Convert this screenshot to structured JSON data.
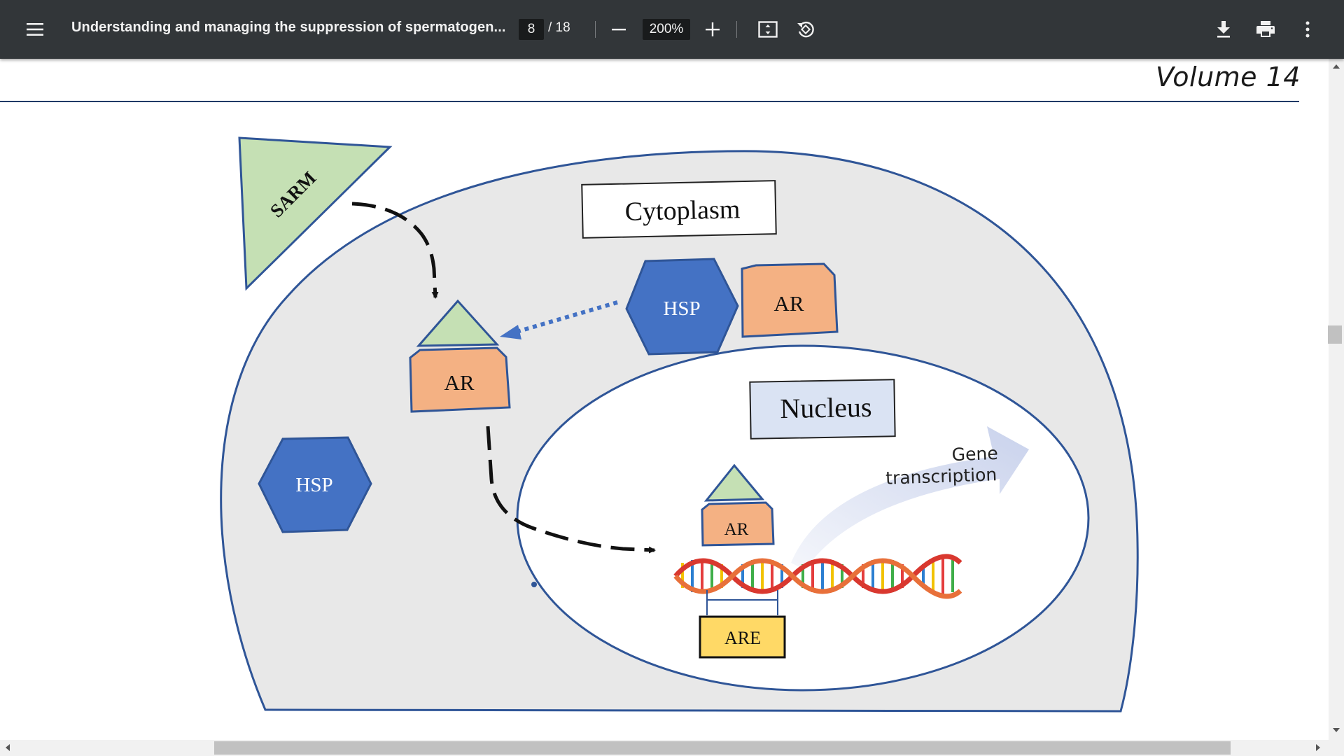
{
  "toolbar": {
    "title": "Understanding and managing the suppression of spermatogen...",
    "current_page": "8",
    "page_total": "/ 18",
    "zoom": "200%",
    "icons": [
      "menu-icon",
      "minus-icon",
      "plus-icon",
      "fit-page-icon",
      "rotate-icon",
      "download-icon",
      "print-icon",
      "more-vert-icon"
    ]
  },
  "page": {
    "header_volume": "Volume 14"
  },
  "figure": {
    "sarm": "SARM",
    "cytoplasm": "Cytoplasm",
    "hsp_top": "HSP",
    "ar_top": "AR",
    "ar_mid": "AR",
    "hsp_left": "HSP",
    "nucleus": "Nucleus",
    "gene_line1": "Gene",
    "gene_line2": "transcription",
    "ar_nucleus": "AR",
    "are": "ARE"
  },
  "colors": {
    "toolbar_bg": "#323639",
    "cell_fill": "#e8e8e8",
    "membrane": "#2f5597",
    "hsp": "#4472c4",
    "ar": "#f4b183",
    "sarm": "#c5e0b4",
    "are": "#ffd966",
    "nucleus_label_bg": "#dae3f3"
  }
}
